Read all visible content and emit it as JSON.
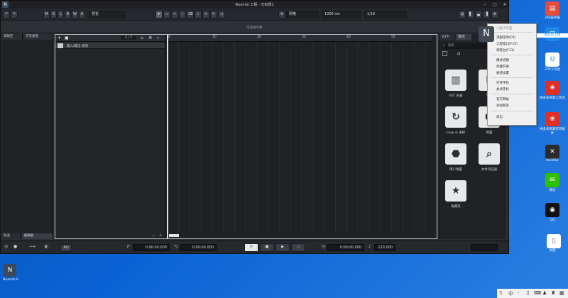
{
  "window": {
    "title": "Nuendo 工程 - 无标题1",
    "info_line": "无选择对象"
  },
  "toolbar": {
    "buttons": [
      "M",
      "S",
      "L",
      "R",
      "W",
      "A"
    ],
    "mode_label": "预览",
    "snap_label": "网格",
    "nudge_label": "1000 ms",
    "quantize_label": "1/16"
  },
  "left_zone": {
    "tabs": [
      "常规区",
      "可见通道"
    ],
    "bottom_tabs": [
      "轨道",
      "编辑器"
    ]
  },
  "project": {
    "track_counter": "2 / 2",
    "track_name": "输入/输出 通道",
    "ruler_ticks": [
      "0",
      "10",
      "20",
      "30",
      "40",
      "50"
    ]
  },
  "right_zone": {
    "tabs": [
      "VSTi",
      "媒体"
    ],
    "search_placeholder": "搜索",
    "tiles": [
      {
        "label": "VST 乐器",
        "icon": "piano-icon",
        "glyph": "▥"
      },
      {
        "label": "VST",
        "icon": "vst-icon",
        "glyph": "F"
      },
      {
        "label": "Loop & 采样",
        "icon": "loop-icon",
        "glyph": "↻"
      },
      {
        "label": "预置",
        "icon": "preset-icon",
        "glyph": "⬢"
      },
      {
        "label": "用户预置",
        "icon": "user-preset-icon",
        "glyph": "⬣"
      },
      {
        "label": "文件浏览器",
        "icon": "file-browser-icon",
        "glyph": "⌕"
      },
      {
        "label": "收藏夹",
        "icon": "favorites-icon",
        "glyph": "★"
      }
    ]
  },
  "transport": {
    "time_left": "0:00:00.000",
    "time_right": "0:00:00.000",
    "time_pos": "0:00:00.000",
    "tempo": "120.000"
  },
  "context_menu": {
    "header": "小粒工作室",
    "items": [
      "顶部菜单(F9)",
      "工程窗口(F10)",
      "调音台(F11)",
      "模式切换",
      "热键开关",
      "通道设置",
      "打开字标",
      "关闭字标",
      "官方网站",
      "添加新签",
      "退出"
    ]
  },
  "desktop": {
    "icons": [
      {
        "label": "360画中画",
        "color": "#e64a3b",
        "glyph": "▤"
      },
      {
        "label": "南京走上岗",
        "color": "#1e88e5",
        "glyph": "◳"
      },
      {
        "label": "千牛工作台",
        "color": "#ffffff",
        "glyph": "U"
      },
      {
        "label": "拼多多商家工作台",
        "color": "#e02e24",
        "glyph": "❀"
      },
      {
        "label": "拼多多商家打印组件",
        "color": "#e02e24",
        "glyph": "❀"
      },
      {
        "label": "KK3952",
        "color": "#2b2b2b",
        "glyph": "✕"
      },
      {
        "label": "微信",
        "color": "#2dc100",
        "glyph": "✉"
      },
      {
        "label": "QQ",
        "color": "#111111",
        "glyph": "◉"
      },
      {
        "label": "文档",
        "color": "#ffffff",
        "glyph": "▯"
      }
    ],
    "shortcut_label": "Nuendo 6"
  }
}
